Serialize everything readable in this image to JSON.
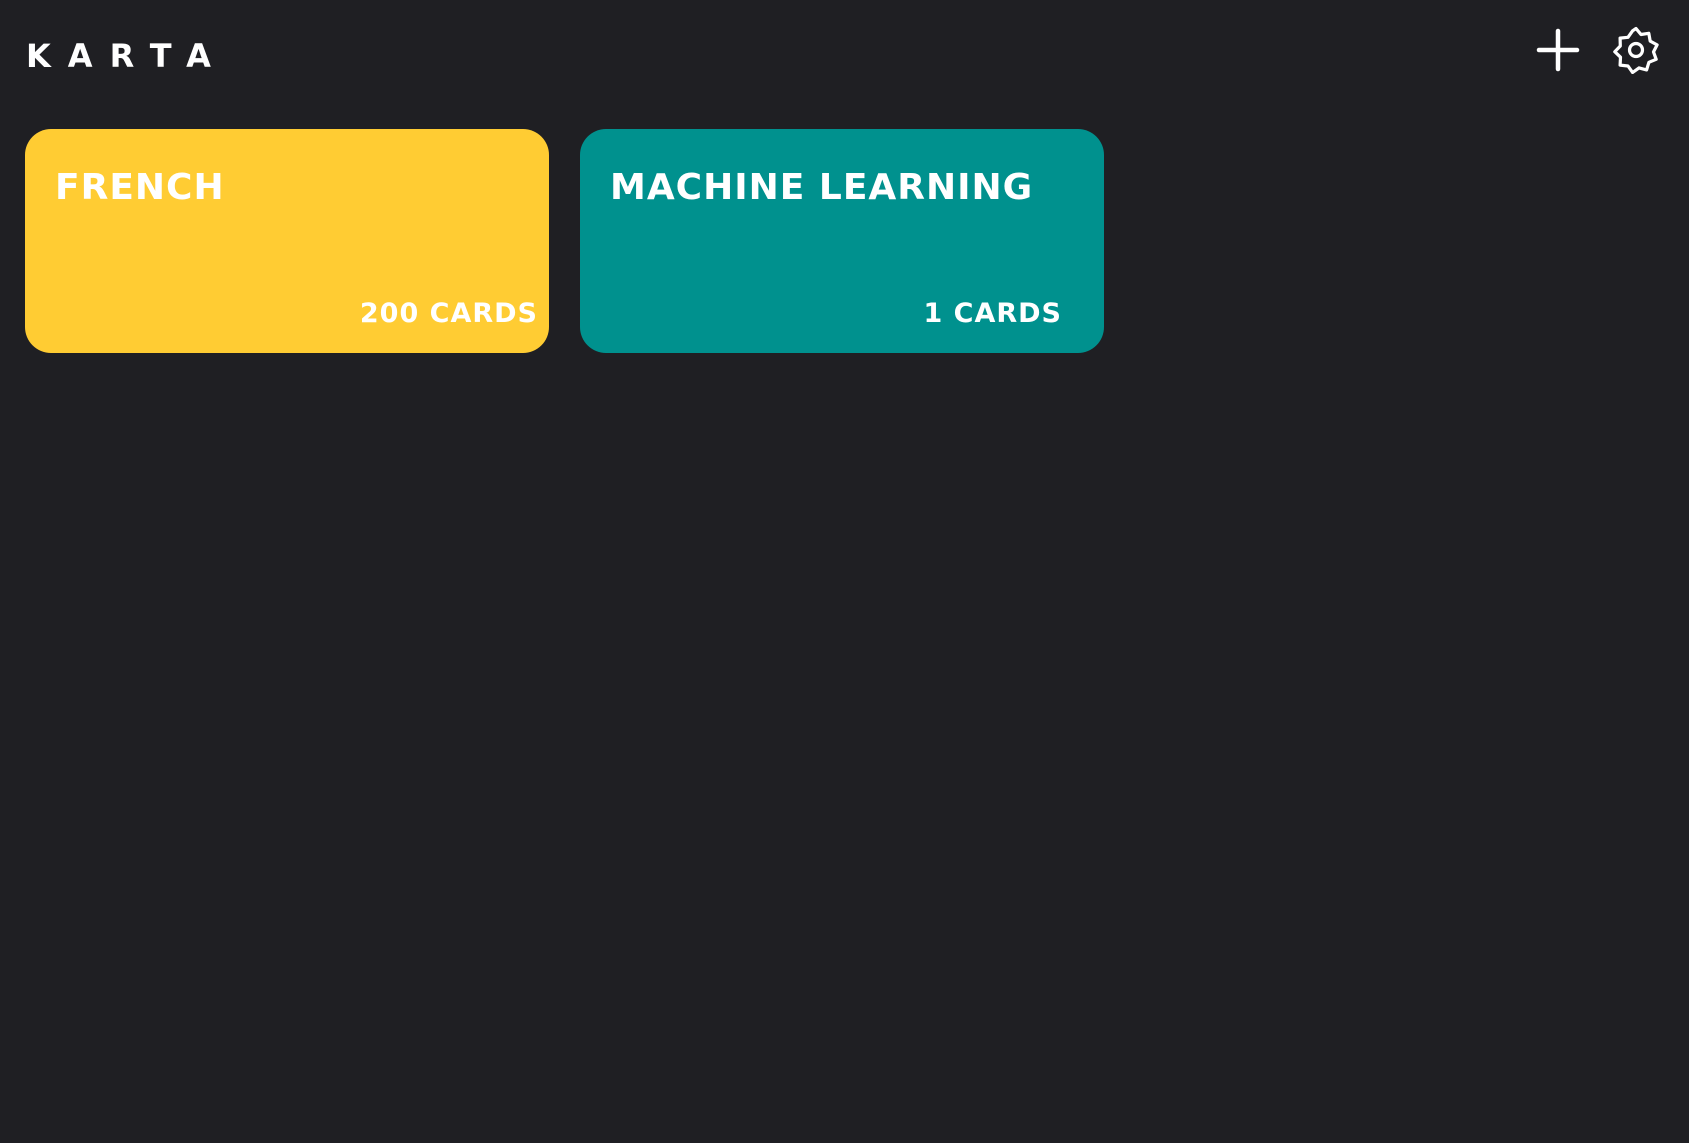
{
  "app": {
    "title": "KARTA"
  },
  "header": {
    "add_icon": "plus-icon",
    "settings_icon": "gear-icon"
  },
  "decks": [
    {
      "title": "FRENCH",
      "count": "200 CARDS",
      "color": "#ffcc33"
    },
    {
      "title": "MACHINE LEARNING",
      "count": "1 CARDS",
      "color": "#00918e"
    }
  ],
  "theme": {
    "background": "#1f1f23",
    "text": "#ffffff"
  }
}
